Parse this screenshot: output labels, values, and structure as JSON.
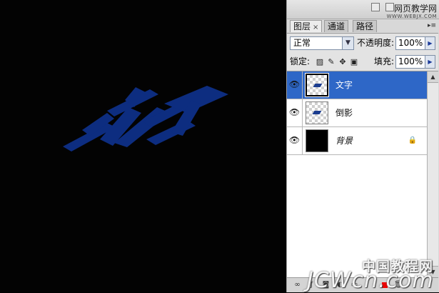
{
  "canvas": {
    "background": "#030303",
    "text_color": "#0d2d80"
  },
  "watermark_top": {
    "line1": "网页教学网",
    "line2": "WWW.WEBJX.COM"
  },
  "panel": {
    "tabs": [
      {
        "label": "图层",
        "close": "×"
      },
      {
        "label": "通道"
      },
      {
        "label": "路径"
      }
    ],
    "blend_mode": "正常",
    "opacity_label": "不透明度:",
    "opacity_value": "100%",
    "lock_label": "锁定:",
    "fill_label": "填充:",
    "fill_value": "100%",
    "layers": [
      {
        "name": "文字",
        "selected": true
      },
      {
        "name": "倒影",
        "selected": false
      },
      {
        "name": "背景",
        "selected": false,
        "locked": true
      }
    ]
  },
  "watermark_bottom": {
    "line1": "中国教程网",
    "line2": "JCWcn.com"
  }
}
